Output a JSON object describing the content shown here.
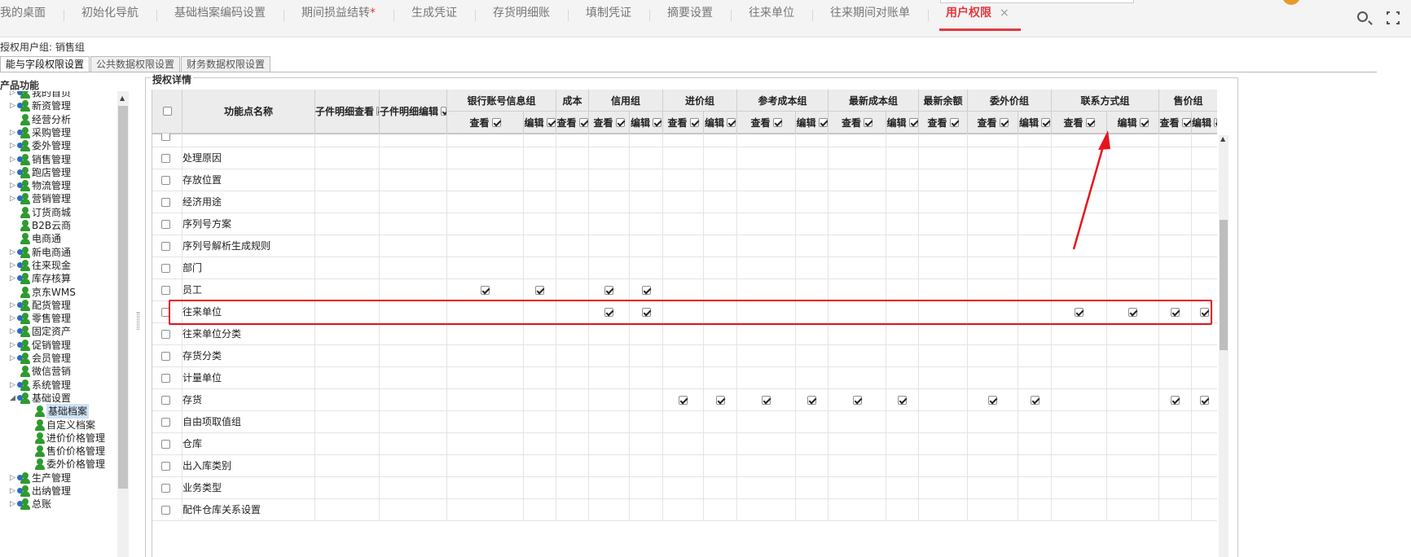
{
  "tabs": [
    {
      "label": "我的桌面",
      "active": false
    },
    {
      "label": "初始化导航",
      "active": false
    },
    {
      "label": "基础档案编码设置",
      "active": false
    },
    {
      "label": "期间损益结转",
      "active": false,
      "modified": "*"
    },
    {
      "label": "生成凭证",
      "active": false
    },
    {
      "label": "存货明细账",
      "active": false
    },
    {
      "label": "填制凭证",
      "active": false
    },
    {
      "label": "摘要设置",
      "active": false
    },
    {
      "label": "往来单位",
      "active": false
    },
    {
      "label": "往来期间对账单",
      "active": false
    },
    {
      "label": "用户权限",
      "active": true,
      "close": "×"
    }
  ],
  "toolbar": {
    "search_icon": "search-icon",
    "expand_icon": "fullscreen-icon"
  },
  "group_line": "授权用户组:   销售组",
  "subtabs": [
    "能与字段权限设置",
    "公共数据权限设置",
    "财务数据权限设置"
  ],
  "tree": {
    "title": "产品功能",
    "items": [
      {
        "label": "我的首页",
        "type": "group",
        "arrow": "▷"
      },
      {
        "label": "新资管理",
        "type": "group",
        "arrow": "▷"
      },
      {
        "label": "经营分析",
        "type": "user",
        "arrow": ""
      },
      {
        "label": "采购管理",
        "type": "group",
        "arrow": "▷"
      },
      {
        "label": "委外管理",
        "type": "group",
        "arrow": "▷"
      },
      {
        "label": "销售管理",
        "type": "group",
        "arrow": "▷"
      },
      {
        "label": "跑店管理",
        "type": "group",
        "arrow": "▷"
      },
      {
        "label": "物流管理",
        "type": "group",
        "arrow": "▷"
      },
      {
        "label": "营销管理",
        "type": "group",
        "arrow": "▷"
      },
      {
        "label": "订货商城",
        "type": "user",
        "arrow": ""
      },
      {
        "label": "B2B云商",
        "type": "user",
        "arrow": ""
      },
      {
        "label": "电商通",
        "type": "user",
        "arrow": ""
      },
      {
        "label": "新电商通",
        "type": "group",
        "arrow": "▷"
      },
      {
        "label": "往来现金",
        "type": "group",
        "arrow": "▷"
      },
      {
        "label": "库存核算",
        "type": "group",
        "arrow": "▷"
      },
      {
        "label": "京东WMS",
        "type": "user",
        "arrow": ""
      },
      {
        "label": "配货管理",
        "type": "group",
        "arrow": "▷"
      },
      {
        "label": "零售管理",
        "type": "group",
        "arrow": "▷"
      },
      {
        "label": "固定资产",
        "type": "group",
        "arrow": "▷"
      },
      {
        "label": "促销管理",
        "type": "group",
        "arrow": "▷"
      },
      {
        "label": "会员管理",
        "type": "group",
        "arrow": "▷"
      },
      {
        "label": "微信营销",
        "type": "user",
        "arrow": ""
      },
      {
        "label": "系统管理",
        "type": "group",
        "arrow": "▷"
      },
      {
        "label": "基础设置",
        "type": "group",
        "arrow": "◢"
      },
      {
        "label": "基础档案",
        "type": "user",
        "arrow": "",
        "child": true,
        "selected": true
      },
      {
        "label": "自定义档案",
        "type": "user",
        "arrow": "",
        "child": true
      },
      {
        "label": "进价价格管理",
        "type": "user",
        "arrow": "",
        "child": true
      },
      {
        "label": "售价价格管理",
        "type": "user",
        "arrow": "",
        "child": true
      },
      {
        "label": "委外价格管理",
        "type": "user",
        "arrow": "",
        "child": true
      },
      {
        "label": "生产管理",
        "type": "group",
        "arrow": "▷"
      },
      {
        "label": "出纳管理",
        "type": "group",
        "arrow": "▷"
      },
      {
        "label": "总账",
        "type": "group",
        "arrow": "▷"
      }
    ]
  },
  "grid": {
    "title": "授权详情",
    "name_header": "功能点名称",
    "sub_detail_view": "子件明细查看",
    "sub_detail_edit": "子件明细编辑",
    "groups": [
      "银行账号信息组",
      "成本",
      "信用组",
      "进价组",
      "参考成本组",
      "最新成本组",
      "最新余额",
      "委外价组",
      "联系方式组",
      "售价组"
    ],
    "view_label": "查看",
    "edit_label": "编辑",
    "columns": [
      {
        "group": 0,
        "label": "查看"
      },
      {
        "group": 0,
        "label": "编辑"
      },
      {
        "group": 1,
        "label": "查看"
      },
      {
        "group": 2,
        "label": "查看"
      },
      {
        "group": 2,
        "label": "编辑"
      },
      {
        "group": 3,
        "label": "查看"
      },
      {
        "group": 3,
        "label": "编辑"
      },
      {
        "group": 4,
        "label": "查看"
      },
      {
        "group": 4,
        "label": "编辑"
      },
      {
        "group": 5,
        "label": "查看"
      },
      {
        "group": 5,
        "label": "编辑"
      },
      {
        "group": 6,
        "label": "查看"
      },
      {
        "group": 7,
        "label": "查看"
      },
      {
        "group": 7,
        "label": "编辑"
      },
      {
        "group": 8,
        "label": "查看"
      },
      {
        "group": 8,
        "label": "编辑"
      },
      {
        "group": 9,
        "label": "查看"
      },
      {
        "group": 9,
        "label": "编辑"
      }
    ],
    "rows": [
      {
        "name": "",
        "checks": []
      },
      {
        "name": "处理原因",
        "checks": []
      },
      {
        "name": "存放位置",
        "checks": []
      },
      {
        "name": "经济用途",
        "checks": []
      },
      {
        "name": "序列号方案",
        "checks": []
      },
      {
        "name": "序列号解析生成规则",
        "checks": []
      },
      {
        "name": "部门",
        "checks": []
      },
      {
        "name": "员工",
        "checks": [
          0,
          1,
          3,
          4
        ]
      },
      {
        "name": "往来单位",
        "checks": [
          3,
          4,
          14,
          15,
          16,
          17
        ],
        "highlighted": true
      },
      {
        "name": "往来单位分类",
        "checks": []
      },
      {
        "name": "存货分类",
        "checks": []
      },
      {
        "name": "计量单位",
        "checks": []
      },
      {
        "name": "存货",
        "checks": [
          5,
          6,
          7,
          8,
          9,
          10,
          12,
          13,
          16,
          17
        ]
      },
      {
        "name": "自由项取值组",
        "checks": []
      },
      {
        "name": "仓库",
        "checks": []
      },
      {
        "name": "出入库类别",
        "checks": []
      },
      {
        "name": "业务类型",
        "checks": []
      },
      {
        "name": "配件仓库关系设置",
        "checks": []
      }
    ]
  },
  "annotation": {
    "highlight_color": "#e8141b",
    "arrow_color": "#e8141b"
  }
}
